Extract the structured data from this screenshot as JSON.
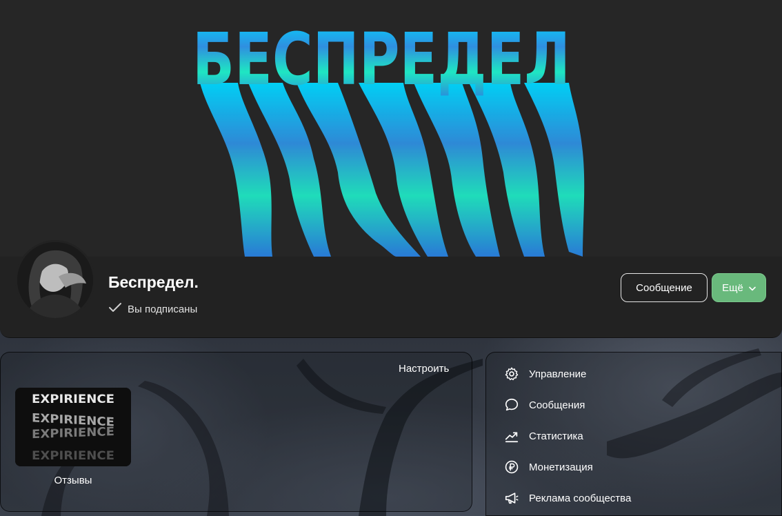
{
  "cover": {
    "text": "БЕСПРЕДЕЛ"
  },
  "profile": {
    "name": "Беспредел.",
    "subscribed_label": "Вы подписаны",
    "message_button": "Сообщение",
    "more_button": "Ещё"
  },
  "widgets": {
    "configure_label": "Настроить",
    "reviews": {
      "label": "Отзывы",
      "thumb_text": "EXPIRIENCE"
    }
  },
  "menu": {
    "items": [
      {
        "label": "Управление",
        "icon": "gear-icon"
      },
      {
        "label": "Сообщения",
        "icon": "chat-bubble-icon"
      },
      {
        "label": "Статистика",
        "icon": "trend-chart-icon"
      },
      {
        "label": "Монетизация",
        "icon": "ruble-coin-icon"
      },
      {
        "label": "Реклама сообщества",
        "icon": "megaphone-icon"
      }
    ]
  },
  "colors": {
    "accent_green": "#69b97c",
    "cover_cyan": "#00d8ff",
    "cover_teal": "#1fe6c2"
  }
}
